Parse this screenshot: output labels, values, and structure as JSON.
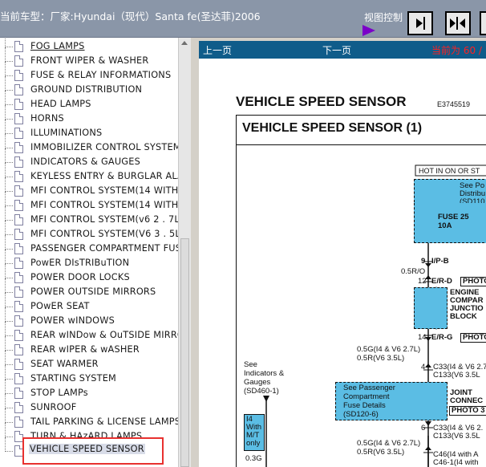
{
  "header": {
    "vehicle_title": "当前车型：厂家:Hyundai（现代）Santa fe(圣达菲)2006",
    "view_control_label": "视图控制"
  },
  "tree": {
    "items": [
      {
        "label": "FOG LAMPS"
      },
      {
        "label": "FRONT WIPER & WASHER"
      },
      {
        "label": "FUSE & RELAY INFORMATIONS"
      },
      {
        "label": "GROUND DISTRIBUTION"
      },
      {
        "label": "HEAD LAMPS"
      },
      {
        "label": "HORNS"
      },
      {
        "label": "ILLUMINATIONS"
      },
      {
        "label": "IMMOBILIZER CONTROL SYSTEM"
      },
      {
        "label": "INDICATORS & GAUGES"
      },
      {
        "label": "KEYLESS ENTRY & BURGLAR ALARM"
      },
      {
        "label": "MFI CONTROL SYSTEM(14 WITH"
      },
      {
        "label": "MFI CONTROL SYSTEM(14 WITH"
      },
      {
        "label": "MFI CONTROL SYSTEM(v6 2 . 7L"
      },
      {
        "label": "MFI CONTROL SYSTEM(V6 3 . 5L"
      },
      {
        "label": "PASSENGER COMPARTMENT FUSE"
      },
      {
        "label": "PowER DIsTRIBuTION"
      },
      {
        "label": "POWER DOOR LOCKS"
      },
      {
        "label": "POWER OUTSIDE MIRRORS"
      },
      {
        "label": "POwER SEAT"
      },
      {
        "label": "POWER wINDOWS"
      },
      {
        "label": "REAR wINDow & OuTSIDE MIRROR"
      },
      {
        "label": "REAR wIPER & wASHER"
      },
      {
        "label": "SEAT WARMER"
      },
      {
        "label": "STARTING SYSTEM"
      },
      {
        "label": "STOP LAMPs"
      },
      {
        "label": "SUNROOF"
      },
      {
        "label": "TAIL PARKING & LICENSE LAMPS"
      },
      {
        "label": "TURN & HAzARD LAMPS"
      }
    ],
    "selected_label": "VEHICLE SPEED SENSOR"
  },
  "nav": {
    "prev_label": "上一页",
    "next_label": "下一页",
    "current_page_text": "当前为 60 /"
  },
  "document": {
    "heading": "VEHICLE SPEED SENSOR",
    "code": "E3745519",
    "frame_title": "VEHICLE SPEED SENSOR (1)",
    "hot_label": "HOT IN ON OR ST",
    "see_power_dist": [
      "See Po",
      "Distribu",
      "(SD110"
    ],
    "fuse": [
      "FUSE 25",
      "10A"
    ],
    "wire1": [
      "9",
      "I/P-B",
      "0.5R/O",
      "12",
      "E/R-D"
    ],
    "photo1": "PHOTO",
    "engine_block": [
      "ENGINE",
      "COMPAR",
      "JUNCTIO",
      "BLOCK"
    ],
    "wire2": [
      "14",
      "E/R-G"
    ],
    "photo2": "PHOTO",
    "wire3": [
      "0.5G(I4 & V6 2.7L)",
      "0.5R(V6 3.5L)",
      "4",
      "C33(I4 & V6 2.7",
      "C133(V6 3.5L"
    ],
    "see_indicators": [
      "See",
      "Indicators &",
      "Gauges",
      "(SD460-1)"
    ],
    "passenger_box": [
      "See Passenger",
      "Compartment",
      "Fuse Details",
      "(SD120-6)"
    ],
    "joint": [
      "JOINT",
      "CONNEC"
    ],
    "photo3": "PHOTO 3",
    "wire4": [
      "6",
      "C33(I4 & V6 2.",
      "C133(V6 3.5L"
    ],
    "mt_box": [
      "I4",
      "With",
      "M/T",
      "only"
    ],
    "wire5": [
      "0.5G(I4 & V6 2.7L)",
      "0.5R(V6 3.5L)",
      "0.3G",
      "C46(I4 with A",
      "C46-1(I4 with"
    ]
  }
}
